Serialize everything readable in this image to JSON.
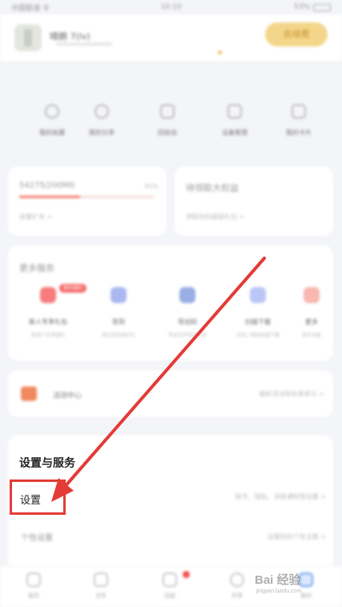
{
  "status_bar": {
    "carrier": "中国联通 令",
    "time": "10:10",
    "battery": "53%"
  },
  "header": {
    "username": "晴朗 7(lv)",
    "vip_label": "去续费"
  },
  "quick_actions": [
    {
      "label": "我的收藏",
      "icon": "star-icon"
    },
    {
      "label": "我的分享",
      "icon": "share-icon"
    },
    {
      "label": "回收站",
      "icon": "trash-icon"
    },
    {
      "label": "设备管理",
      "icon": "devices-icon"
    },
    {
      "label": "我的卡片",
      "icon": "card-icon"
    }
  ],
  "storage_card": {
    "value": "54275/200M0",
    "percent": "45%",
    "fill_fraction": 0.45,
    "sub": "容量扩充 >"
  },
  "vip_card": {
    "title": "待领取大权益",
    "sub": "领取你的超级礼包 >"
  },
  "more_services": {
    "title": "更多服务",
    "badge": "限时福利",
    "items": [
      {
        "label": "新人专享礼包",
        "sub": "新用户专享福利",
        "color": "#f77c7c"
      },
      {
        "label": "签到",
        "sub": "每日签到领好礼",
        "color": "#aab8f2"
      },
      {
        "label": "导出码",
        "sub": "导出文件快速分享",
        "color": "#9aaee6"
      },
      {
        "label": "扫描下载",
        "sub": "识别二维码快速下载",
        "color": "#b9c7f6"
      },
      {
        "label": "更多",
        "sub": "更多功能",
        "color": "#f8b7b0"
      }
    ]
  },
  "activity": {
    "label": "活动中心",
    "right": "精彩活动等你来参与 >"
  },
  "settings_section": {
    "title": "设置与服务",
    "settings_label": "设置",
    "settings_right": "账号、隐私、消息通知等设置 >",
    "personal_label": "个性设置",
    "personal_right": "设置你的个性主题 >"
  },
  "tabbar": {
    "tabs": [
      "首页",
      "文件",
      "动态",
      "共享",
      "我的"
    ]
  },
  "watermark": {
    "brand": "Bai 经验",
    "url": "jingyan.baidu.com"
  },
  "colors": {
    "accent_red": "#e33b36",
    "vip_gold": "#f3d68a"
  }
}
